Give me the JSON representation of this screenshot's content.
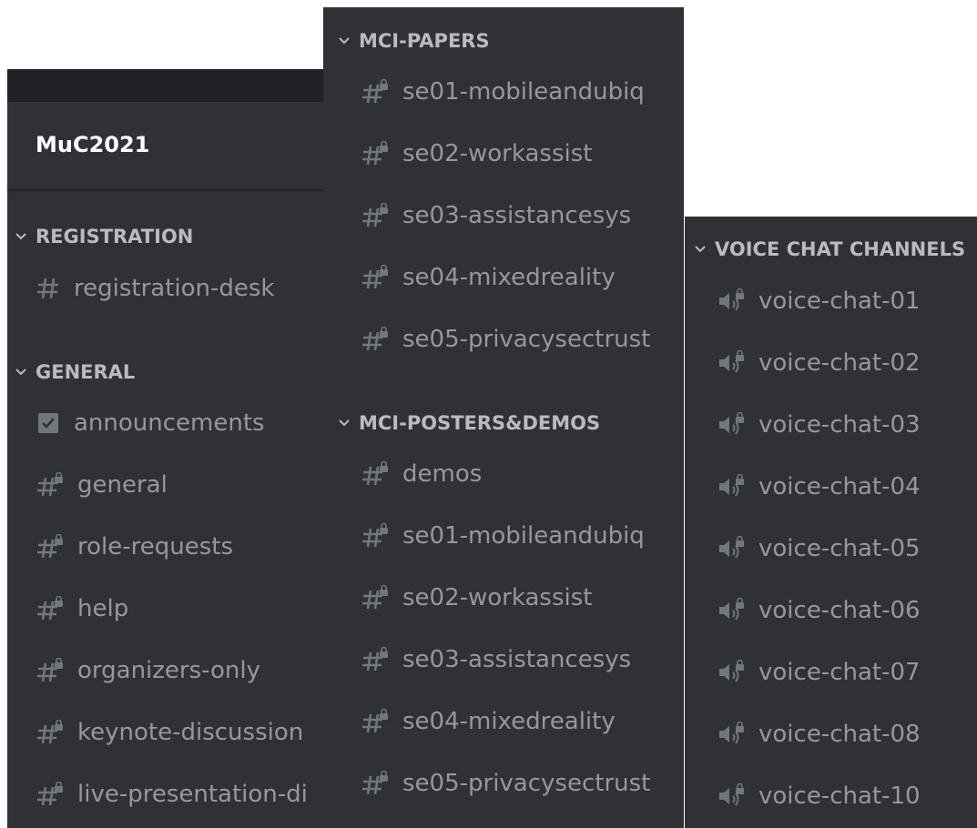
{
  "server": {
    "name": "MuC2021"
  },
  "panel_left": {
    "categories": [
      {
        "label": "REGISTRATION",
        "channels": [
          {
            "name": "registration-desk",
            "icon": "hash-icon"
          }
        ]
      },
      {
        "label": "GENERAL",
        "channels": [
          {
            "name": "announcements",
            "icon": "announcement-icon"
          },
          {
            "name": "general",
            "icon": "locked-hash-icon"
          },
          {
            "name": "role-requests",
            "icon": "locked-hash-icon"
          },
          {
            "name": "help",
            "icon": "locked-hash-icon"
          },
          {
            "name": "organizers-only",
            "icon": "locked-hash-icon"
          },
          {
            "name": "keynote-discussion",
            "icon": "locked-hash-icon"
          },
          {
            "name": "live-presentation-di",
            "icon": "locked-hash-icon"
          }
        ]
      }
    ]
  },
  "panel_mid": {
    "categories": [
      {
        "label": "MCI-PAPERS",
        "channels": [
          {
            "name": "se01-mobileandubiq",
            "icon": "locked-hash-icon"
          },
          {
            "name": "se02-workassist",
            "icon": "locked-hash-icon"
          },
          {
            "name": "se03-assistancesys",
            "icon": "locked-hash-icon"
          },
          {
            "name": "se04-mixedreality",
            "icon": "locked-hash-icon"
          },
          {
            "name": "se05-privacysectrust",
            "icon": "locked-hash-icon"
          }
        ]
      },
      {
        "label": "MCI-POSTERS&DEMOS",
        "channels": [
          {
            "name": "demos",
            "icon": "locked-hash-icon"
          },
          {
            "name": "se01-mobileandubiq",
            "icon": "locked-hash-icon"
          },
          {
            "name": "se02-workassist",
            "icon": "locked-hash-icon"
          },
          {
            "name": "se03-assistancesys",
            "icon": "locked-hash-icon"
          },
          {
            "name": "se04-mixedreality",
            "icon": "locked-hash-icon"
          },
          {
            "name": "se05-privacysectrust",
            "icon": "locked-hash-icon"
          }
        ]
      }
    ]
  },
  "panel_right": {
    "categories": [
      {
        "label": "VOICE CHAT CHANNELS",
        "channels": [
          {
            "name": "voice-chat-01",
            "icon": "locked-speaker-icon"
          },
          {
            "name": "voice-chat-02",
            "icon": "locked-speaker-icon"
          },
          {
            "name": "voice-chat-03",
            "icon": "locked-speaker-icon"
          },
          {
            "name": "voice-chat-04",
            "icon": "locked-speaker-icon"
          },
          {
            "name": "voice-chat-05",
            "icon": "locked-speaker-icon"
          },
          {
            "name": "voice-chat-06",
            "icon": "locked-speaker-icon"
          },
          {
            "name": "voice-chat-07",
            "icon": "locked-speaker-icon"
          },
          {
            "name": "voice-chat-08",
            "icon": "locked-speaker-icon"
          },
          {
            "name": "voice-chat-10",
            "icon": "locked-speaker-icon"
          }
        ]
      }
    ]
  },
  "colors": {
    "panel_bg": "#2f3136",
    "topbar_bg": "#202225",
    "channel_text": "#96989d",
    "category_text": "#b9bbbe",
    "server_name": "#ffffff"
  }
}
